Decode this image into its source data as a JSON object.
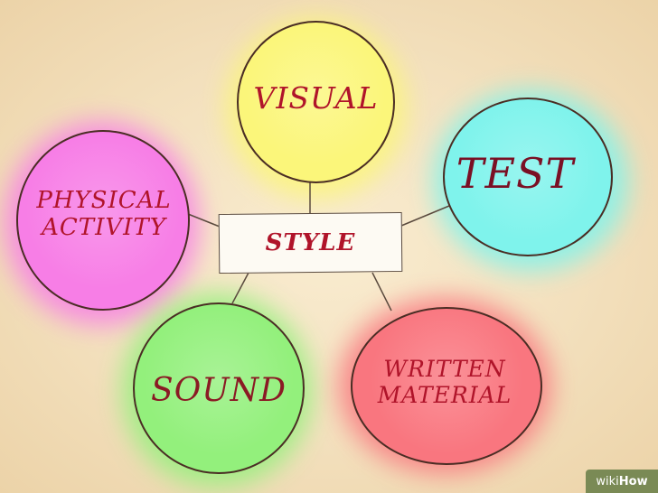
{
  "diagram": {
    "center": {
      "label": "STYLE"
    },
    "nodes": [
      {
        "id": "visual",
        "label": "VISUAL",
        "color": "#fbf67a"
      },
      {
        "id": "test",
        "label": "TEST",
        "color": "#7ff3ec"
      },
      {
        "id": "physical-activity",
        "label": "PHYSICAL\nACTIVITY",
        "color": "#f77ee6"
      },
      {
        "id": "sound",
        "label": "SOUND",
        "color": "#93f07c"
      },
      {
        "id": "written-material",
        "label": "WRITTEN\nMATERIAL",
        "color": "#f9767f"
      }
    ]
  },
  "watermark": {
    "prefix": "wiki",
    "suffix": "How",
    "color": "#7a8a55"
  }
}
